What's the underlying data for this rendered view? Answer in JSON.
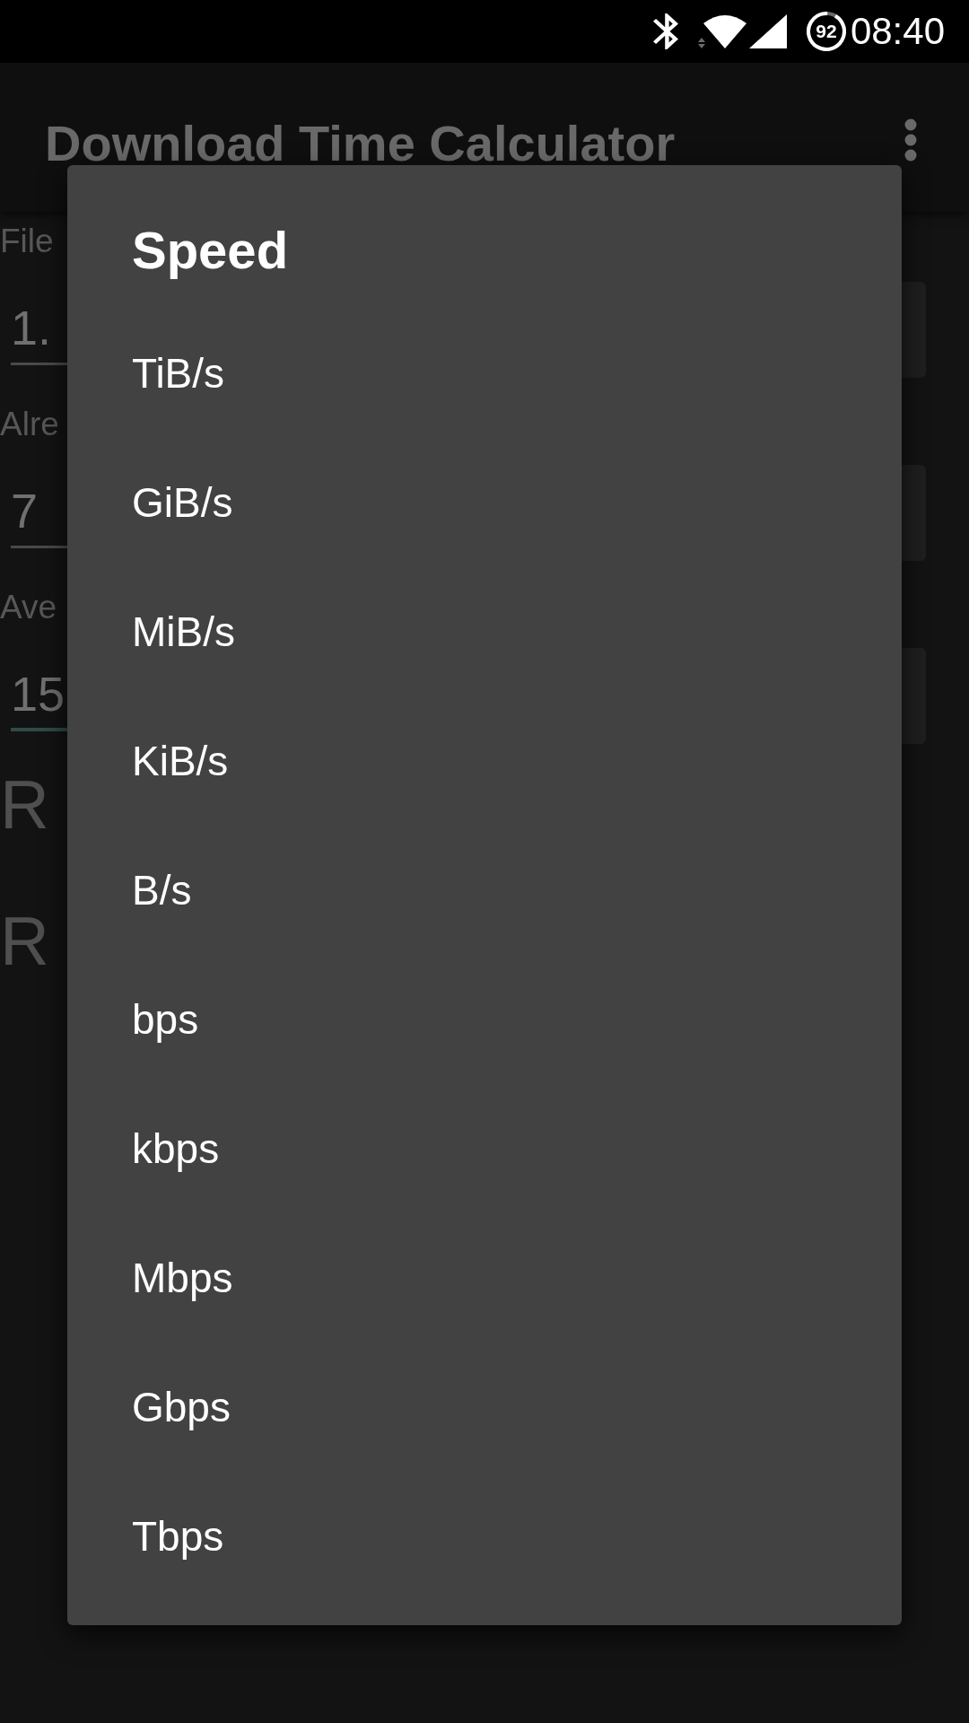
{
  "status_bar": {
    "battery_percent": "92",
    "time": "08:40"
  },
  "app_bar": {
    "title": "Download Time Calculator"
  },
  "form": {
    "fields": [
      {
        "label": "File",
        "value": "1.",
        "focused": false
      },
      {
        "label": "Alre",
        "value": "7",
        "focused": false
      },
      {
        "label": "Ave",
        "value": "15",
        "focused": true
      }
    ],
    "results": [
      "R",
      "R"
    ]
  },
  "dialog": {
    "title": "Speed",
    "options": [
      "TiB/s",
      "GiB/s",
      "MiB/s",
      "KiB/s",
      "B/s",
      "bps",
      "kbps",
      "Mbps",
      "Gbps",
      "Tbps"
    ]
  }
}
